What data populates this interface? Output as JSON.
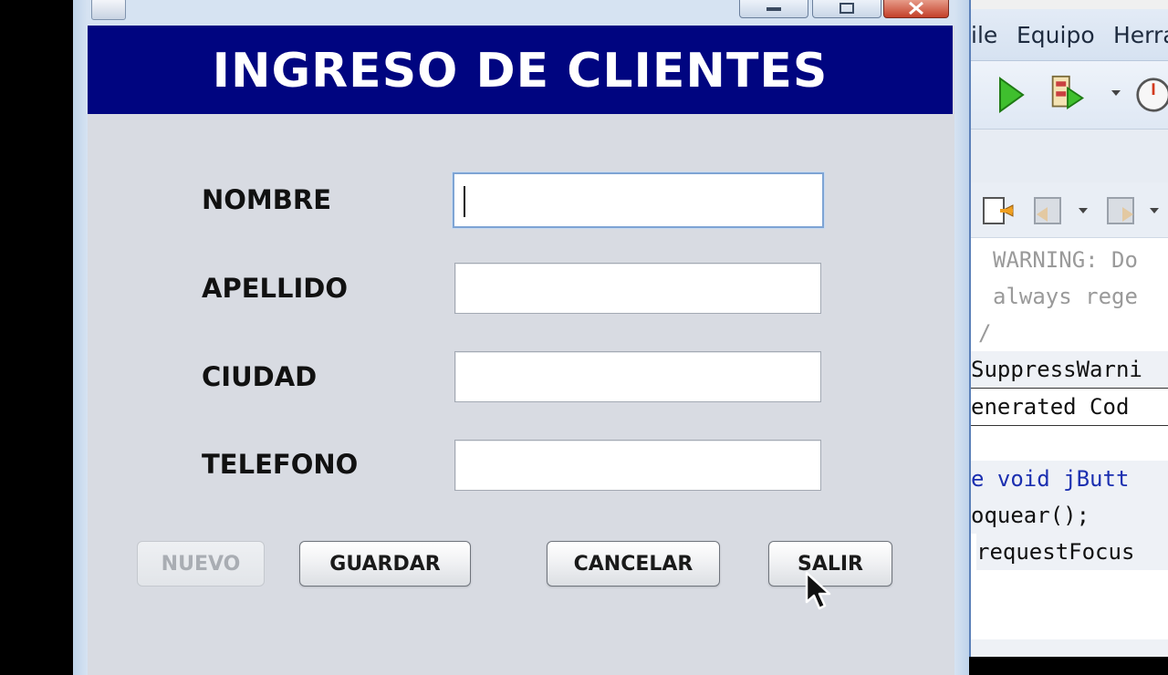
{
  "ide": {
    "menu": [
      "ile",
      "Equipo",
      "Herra"
    ],
    "code_lines": [
      "WARNING: Do",
      "always rege",
      "/",
      "SuppressWarni",
      "enerated Cod",
      "",
      "e void jButt",
      "oquear();",
      "requestFocus"
    ]
  },
  "dialog": {
    "header_title": "INGRESO DE CLIENTES",
    "fields": [
      {
        "label": "NOMBRE",
        "value": ""
      },
      {
        "label": "APELLIDO",
        "value": ""
      },
      {
        "label": "CIUDAD",
        "value": ""
      },
      {
        "label": "TELEFONO",
        "value": ""
      }
    ],
    "buttons": {
      "nuevo": "NUEVO",
      "guardar": "GUARDAR",
      "cancelar": "CANCELAR",
      "salir": "SALIR"
    }
  },
  "colors": {
    "header_band": "#000580",
    "client_bg": "#d8dbe2",
    "focus_border": "#7ea4d4"
  }
}
